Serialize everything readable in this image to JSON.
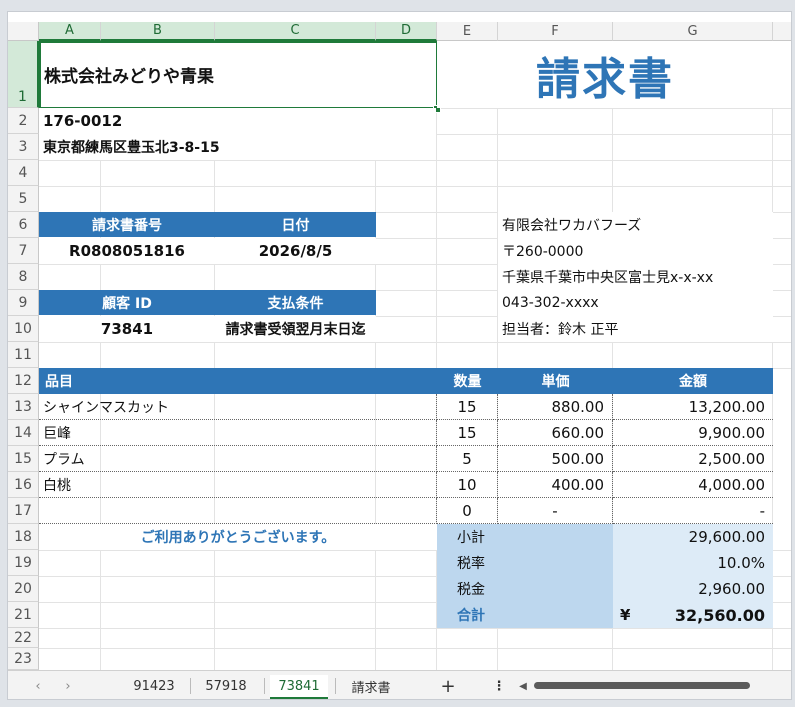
{
  "columns": [
    "A",
    "B",
    "C",
    "D",
    "E",
    "F",
    "G"
  ],
  "rows": [
    "1",
    "2",
    "3",
    "4",
    "5",
    "6",
    "7",
    "8",
    "9",
    "10",
    "11",
    "12",
    "13",
    "14",
    "15",
    "16",
    "17",
    "18",
    "19",
    "20",
    "21",
    "22",
    "23"
  ],
  "seller": {
    "company": "株式会社みどりや青果",
    "postal": "176-0012",
    "address": "東京都練馬区豊玉北3-8-15"
  },
  "title": "請求書",
  "invoice": {
    "number_label": "請求書番号",
    "date_label": "日付",
    "number": "R0808051816",
    "date": "2026/8/5",
    "customer_label": "顧客 ID",
    "terms_label": "支払条件",
    "customer_id": "73841",
    "terms": "請求書受領翌月末日迄"
  },
  "customer": {
    "name": "有限会社ワカバフーズ",
    "postal": "〒260-0000",
    "address": "千葉県千葉市中央区富士見x-x-xx",
    "phone": "043-302-xxxx",
    "contact": "担当者：鈴木 正平"
  },
  "items_header": {
    "item": "品目",
    "qty": "数量",
    "price": "単価",
    "amount": "金額"
  },
  "items": [
    {
      "name": "シャインマスカット",
      "qty": "15",
      "price": "880.00",
      "amount": "13,200.00"
    },
    {
      "name": "巨峰",
      "qty": "15",
      "price": "660.00",
      "amount": "9,900.00"
    },
    {
      "name": "プラム",
      "qty": "5",
      "price": "500.00",
      "amount": "2,500.00"
    },
    {
      "name": "白桃",
      "qty": "10",
      "price": "400.00",
      "amount": "4,000.00"
    },
    {
      "name": "",
      "qty": "0",
      "price": "-",
      "amount": "-"
    }
  ],
  "thanks": "ご利用ありがとうございます。",
  "totals": {
    "subtotal_label": "小計",
    "subtotal": "29,600.00",
    "taxrate_label": "税率",
    "taxrate": "10.0%",
    "tax_label": "税金",
    "tax": "2,960.00",
    "total_label": "合計",
    "currency": "¥",
    "total": "32,560.00"
  },
  "sheet_tabs": [
    "91423",
    "57918",
    "73841",
    "請求書"
  ],
  "active_tab": "73841",
  "colors": {
    "header_blue": "#2e75b6",
    "light_blue": "#bdd7ee",
    "title_blue": "#2e75b6",
    "excel_green": "#1f7a3a"
  }
}
